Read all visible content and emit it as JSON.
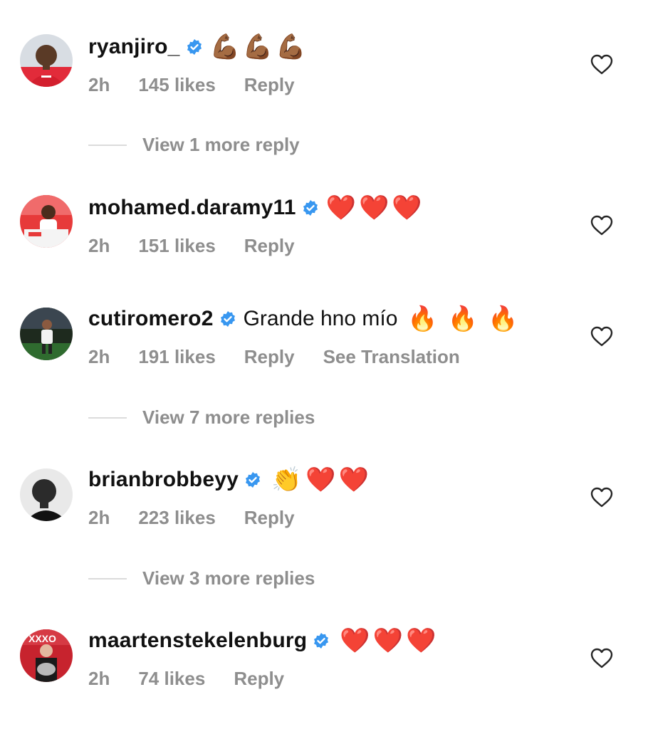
{
  "comments": [
    {
      "username": "ryanjiro_",
      "text": "",
      "emojis": [
        "💪🏾",
        "💪🏾",
        "💪🏾"
      ],
      "time": "2h",
      "likes": "145 likes",
      "reply_label": "Reply",
      "view_replies": "View 1 more reply"
    },
    {
      "username": "mohamed.daramy11",
      "text": "",
      "emojis": [
        "❤️",
        "❤️",
        "❤️"
      ],
      "time": "2h",
      "likes": "151 likes",
      "reply_label": "Reply"
    },
    {
      "username": "cutiromero2",
      "text": "Grande hno mío",
      "emojis": [
        "🔥",
        "🔥",
        "🔥"
      ],
      "time": "2h",
      "likes": "191 likes",
      "reply_label": "Reply",
      "translation_label": "See Translation",
      "view_replies": "View 7 more replies"
    },
    {
      "username": "brianbrobbeyy",
      "text": "",
      "emojis": [
        "👏",
        "❤️",
        "❤️"
      ],
      "time": "2h",
      "likes": "223 likes",
      "reply_label": "Reply",
      "view_replies": "View 3 more replies"
    },
    {
      "username": "maartenstekelenburg",
      "text": "",
      "emojis": [
        "❤️",
        "❤️",
        "❤️"
      ],
      "time": "2h",
      "likes": "74 likes",
      "reply_label": "Reply"
    }
  ],
  "colors": {
    "verified_badge": "#3897f0",
    "meta_text": "#8e8e8e",
    "heart_emoji": "#e8202c",
    "muscle_emoji": "#7b4a2a"
  },
  "icons": {
    "verified": "verified-badge-icon",
    "like": "heart-outline-icon"
  }
}
